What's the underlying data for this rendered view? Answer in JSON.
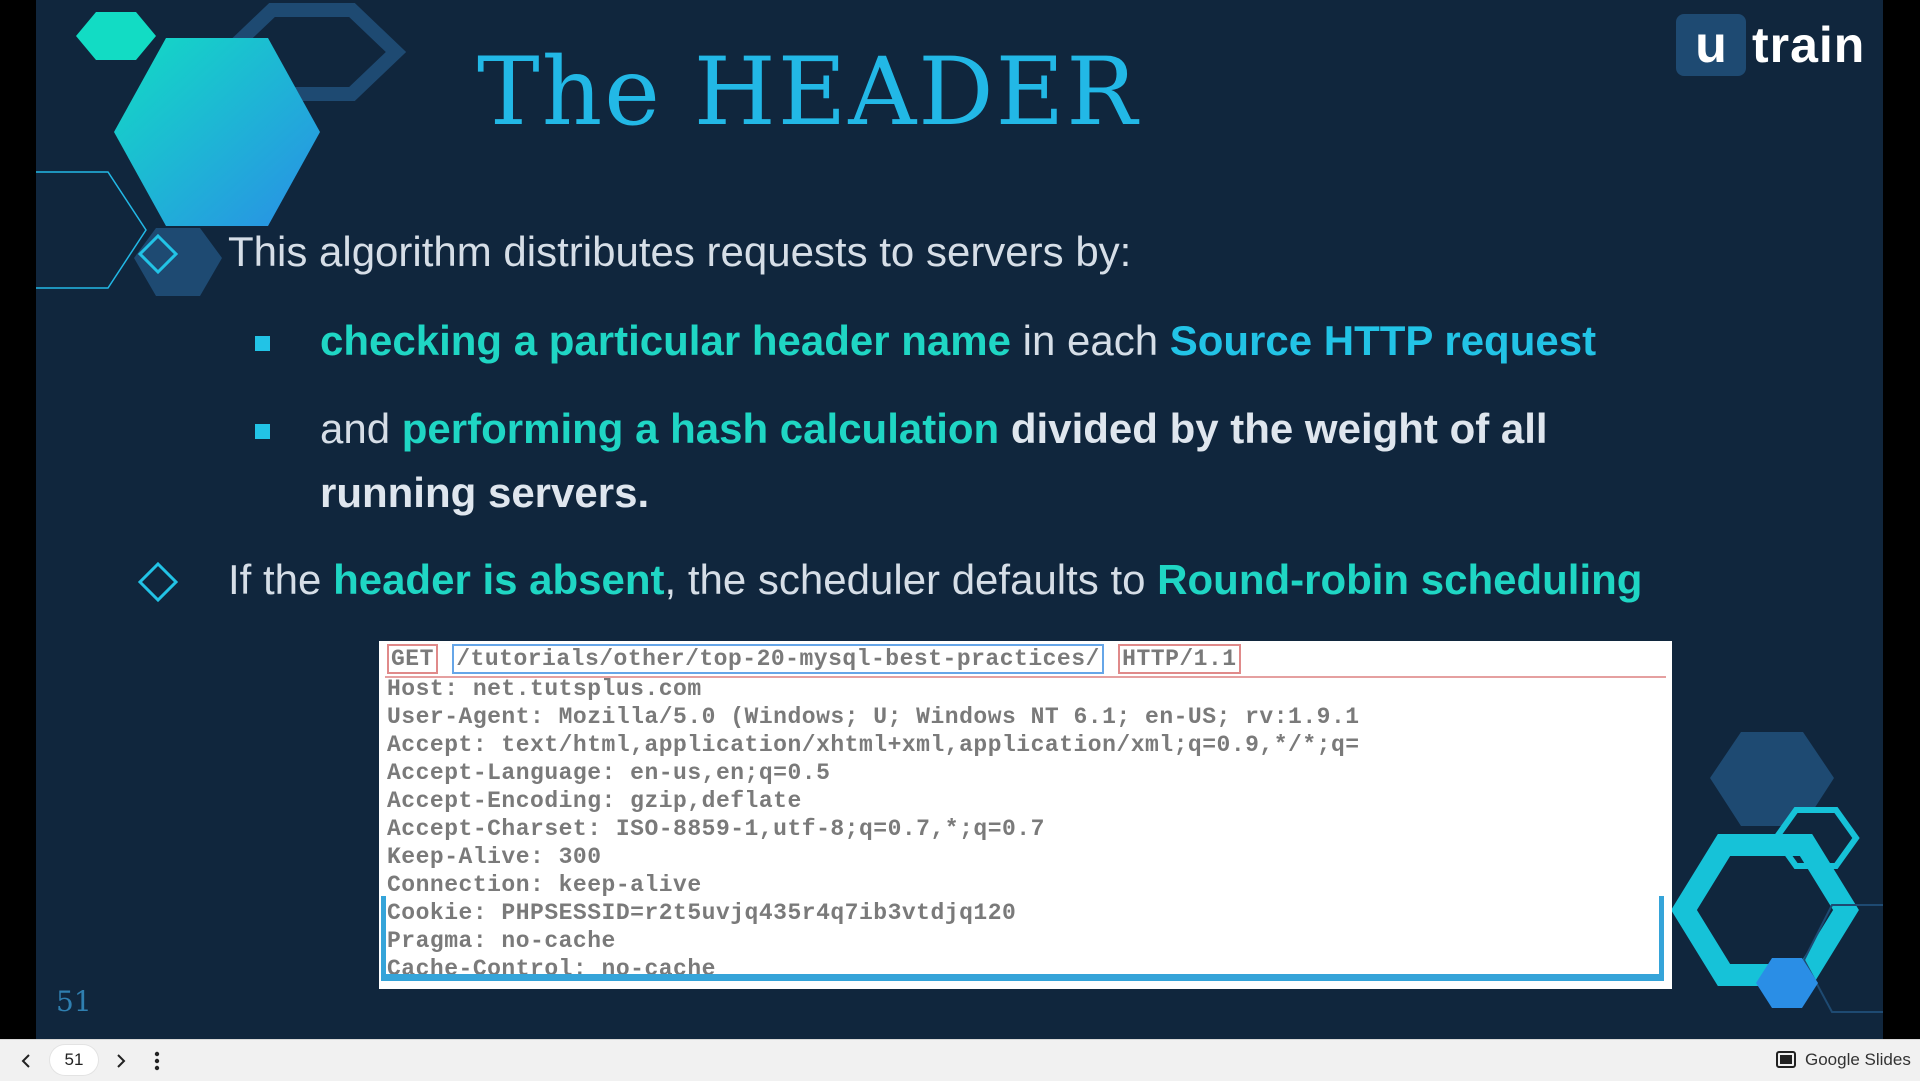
{
  "slide": {
    "title": "The HEADER",
    "logo": {
      "u": "u",
      "train": "train"
    },
    "intro": "This algorithm distributes requests to servers by:",
    "bullet1": {
      "part1": "checking a particular header name",
      "part2": " in each ",
      "part3": "Source HTTP request"
    },
    "bullet2": {
      "part1": "and ",
      "part2": "performing a hash calculation",
      "part3": " divided by the weight of all",
      "part4": "running servers."
    },
    "point2": {
      "part1": "If the ",
      "part2": "header is absent",
      "part3": ", the scheduler defaults to ",
      "part4": "Round-robin scheduling"
    },
    "page_number": "51"
  },
  "http_request": {
    "method": "GET",
    "path": "/tutorials/other/top-20-mysql-best-practices/",
    "version": "HTTP/1.1",
    "lines": [
      "Host: net.tutsplus.com",
      "User-Agent: Mozilla/5.0 (Windows; U; Windows NT 6.1; en-US; rv:1.9.1",
      "Accept: text/html,application/xhtml+xml,application/xml;q=0.9,*/*;q=",
      "Accept-Language: en-us,en;q=0.5",
      "Accept-Encoding: gzip,deflate",
      "Accept-Charset: ISO-8859-1,utf-8;q=0.7,*;q=0.7",
      "Keep-Alive: 300",
      "Connection: keep-alive",
      "Cookie: PHPSESSID=r2t5uvjq435r4q7ib3vtdjq120",
      "Pragma: no-cache",
      "Cache-Control: no-cache"
    ]
  },
  "toolbar": {
    "current_page": "51",
    "prev_icon": "chevron-left-icon",
    "next_icon": "chevron-right-icon",
    "more_icon": "more-vertical-icon",
    "app_label": "Google Slides"
  },
  "colors": {
    "background": "#10263d",
    "title": "#22b8e6",
    "highlight": "#1fd6c4",
    "accent": "#22c3e6"
  }
}
